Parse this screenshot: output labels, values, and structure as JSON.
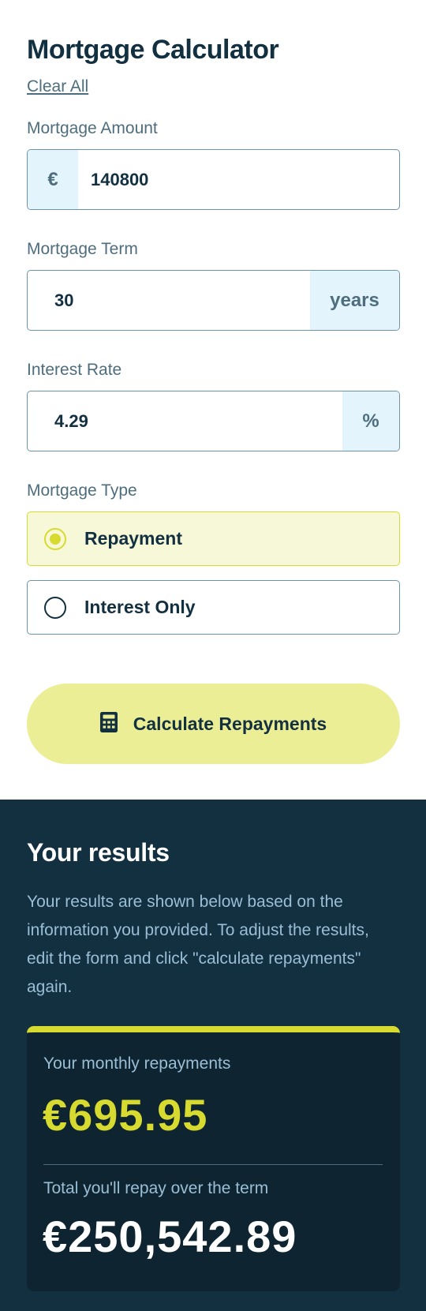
{
  "calculator": {
    "title": "Mortgage Calculator",
    "clear_label": "Clear All",
    "amount": {
      "label": "Mortgage Amount",
      "prefix": "€",
      "value": "140800"
    },
    "term": {
      "label": "Mortgage Term",
      "value": "30",
      "suffix": "years"
    },
    "rate": {
      "label": "Interest Rate",
      "value": "4.29",
      "suffix": "%"
    },
    "type": {
      "label": "Mortgage Type",
      "options": [
        {
          "label": "Repayment",
          "selected": true
        },
        {
          "label": "Interest Only",
          "selected": false
        }
      ]
    },
    "calculate_label": "Calculate Repayments",
    "calculate_icon": "calculator-icon"
  },
  "results": {
    "title": "Your results",
    "description": "Your results are shown below based on the information you provided. To adjust the results, edit the form and click \"calculate repayments\" again.",
    "monthly_label": "Your monthly repayments",
    "monthly_value": "€695.95",
    "total_label": "Total you'll repay over the term",
    "total_value": "€250,542.89"
  },
  "colors": {
    "dark": "#133041",
    "accent": "#d8db2f",
    "accent_light": "#ebee95",
    "muted": "#4e6e7e",
    "field_tint": "#e4f4fd"
  }
}
